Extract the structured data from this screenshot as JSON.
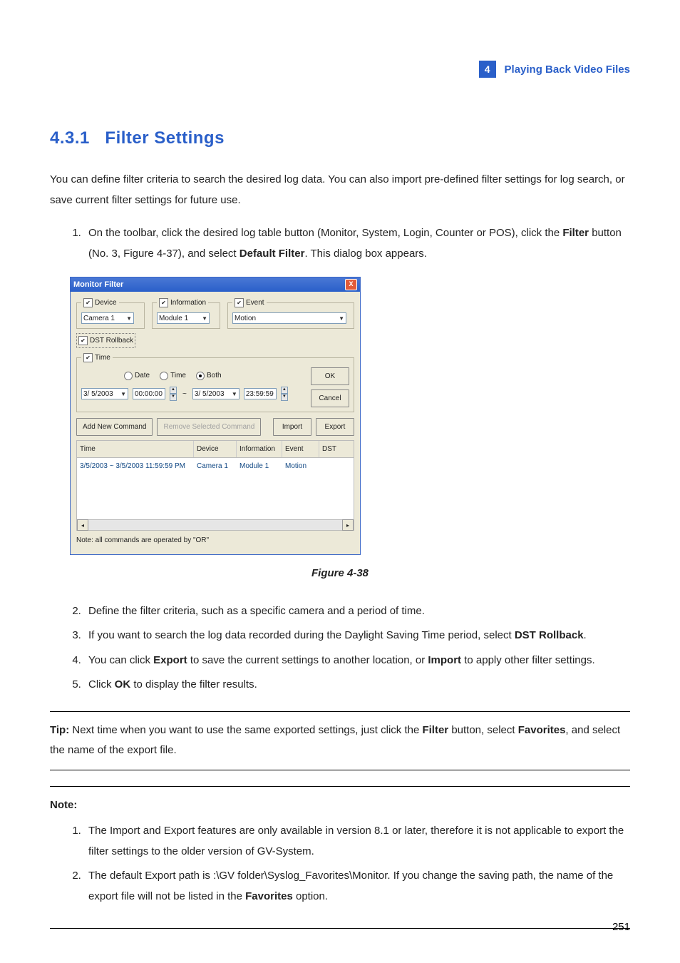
{
  "header": {
    "num": "4",
    "title": "Playing Back Video Files"
  },
  "section": {
    "num": "4.3.1",
    "title": "Filter Settings"
  },
  "intro": "You can define filter criteria to search the desired log data. You can also import pre-defined filter settings for log search, or save current filter settings for future use.",
  "step1": {
    "pre": "On the toolbar, click the desired log table button (Monitor, System, Login, Counter or POS), click the ",
    "b1": "Filter",
    "mid": " button (No. 3, Figure 4-37), and select ",
    "b2": "Default Filter",
    "post": ". This dialog box appears."
  },
  "dialog": {
    "title": "Monitor Filter",
    "device": {
      "label": "Device",
      "value": "Camera 1"
    },
    "info": {
      "label": "Information",
      "value": "Module 1"
    },
    "event": {
      "label": "Event",
      "value": "Motion"
    },
    "dst": "DST Rollback",
    "time": {
      "group": "Time",
      "optDate": "Date",
      "optTime": "Time",
      "optBoth": "Both",
      "d1": "3/  5/2003",
      "t1": "00:00:00",
      "d2": "3/  5/2003",
      "t2": "23:59:59"
    },
    "btns": {
      "ok": "OK",
      "cancel": "Cancel",
      "add": "Add New Command",
      "remove": "Remove Selected Command",
      "import": "Import",
      "export": "Export"
    },
    "cols": {
      "time": "Time",
      "device": "Device",
      "info": "Information",
      "event": "Event",
      "dst": "DST"
    },
    "row": {
      "time": "3/5/2003 ~ 3/5/2003 11:59:59 PM",
      "device": "Camera 1",
      "info": "Module 1",
      "event": "Motion"
    },
    "note": "Note: all commands are operated by \"OR\""
  },
  "figcap": "Figure 4-38",
  "step2": "Define the filter criteria, such as a specific camera and a period of time.",
  "step3": {
    "pre": "If you want to search the log data recorded during the Daylight Saving Time period, select ",
    "b": "DST Rollback",
    "post": "."
  },
  "step4": {
    "pre": "You can click ",
    "b1": "Export",
    "mid": " to save the current settings to another location, or ",
    "b2": "Import",
    "post": " to apply other filter settings."
  },
  "step5": {
    "pre": "Click ",
    "b": "OK",
    "post": " to display the filter results."
  },
  "tip": {
    "label": "Tip:",
    "pre": " Next time when you want to use the same exported settings, just click the ",
    "b1": "Filter",
    "mid1": " button, select ",
    "b2": "Favorites",
    "post": ", and select the name of the export file."
  },
  "note": {
    "label": "Note:",
    "n1": "The Import and Export features are only available in version 8.1 or later, therefore it is not applicable to export the filter settings to the older version of GV-System.",
    "n2": {
      "pre": "The default Export path is :\\GV folder\\Syslog_Favorites\\Monitor. If you change the saving path, the name of the export file will not be listed in the ",
      "b": "Favorites",
      "post": " option."
    }
  },
  "pagenum": "251"
}
